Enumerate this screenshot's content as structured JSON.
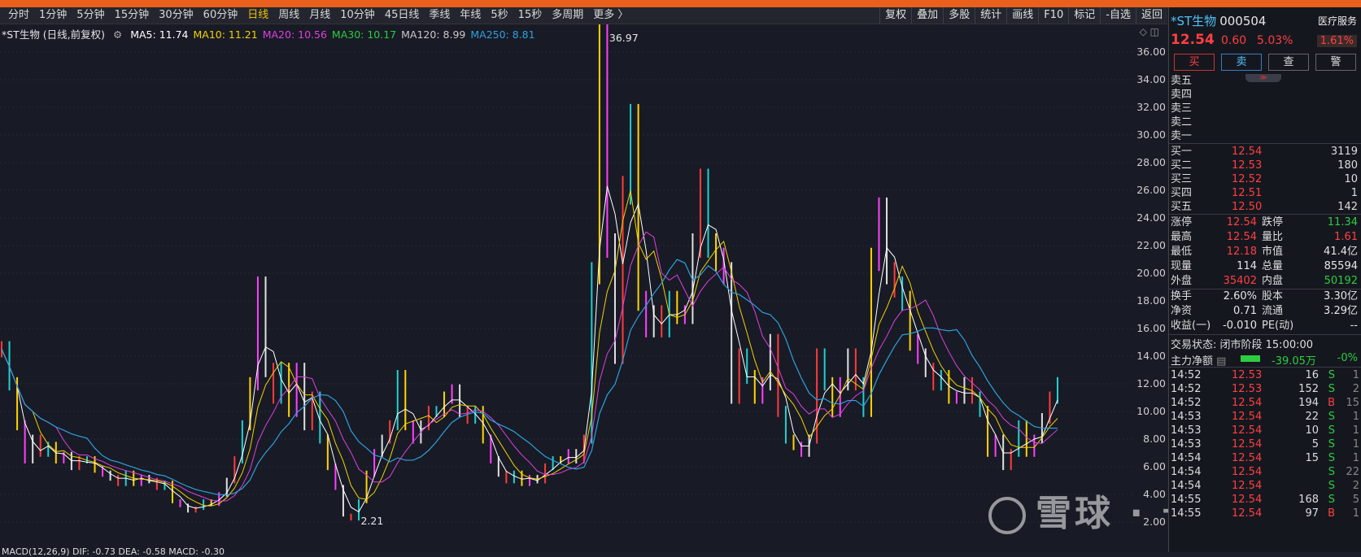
{
  "periods": [
    "分时",
    "1分钟",
    "5分钟",
    "15分钟",
    "30分钟",
    "60分钟",
    "日线",
    "周线",
    "月线",
    "10分钟",
    "45日线",
    "季线",
    "年线",
    "5秒",
    "15秒",
    "多周期",
    "更多 〉"
  ],
  "active_period": "日线",
  "tools": [
    "复权",
    "叠加",
    "多股",
    "统计",
    "画线",
    "F10",
    "标记",
    "-自选",
    "返回"
  ],
  "chart_title": "*ST生物 (日线,前复权)",
  "ma": [
    {
      "label": "MA5: 11.74",
      "color": "#ffffff"
    },
    {
      "label": "MA10: 11.21",
      "color": "#f5d000"
    },
    {
      "label": "MA20: 10.56",
      "color": "#e040e0"
    },
    {
      "label": "MA30: 10.17",
      "color": "#2ecc40"
    },
    {
      "label": "MA120: 8.99",
      "color": "#c8c8c8"
    },
    {
      "label": "MA250: 8.81",
      "color": "#2f9fe0"
    }
  ],
  "y_ticks": [
    "36.00",
    "34.00",
    "32.00",
    "30.00",
    "28.00",
    "26.00",
    "24.00",
    "22.00",
    "20.00",
    "18.00",
    "16.00",
    "14.00",
    "12.00",
    "10.00",
    "8.00",
    "6.00",
    "4.00",
    "2.00"
  ],
  "high_label": "36.97",
  "low_label": "2.21",
  "bottom_indicator": "MACD(12,26,9)  DIF: -0.73  DEA: -0.58  MACD: -0.30",
  "watermark": "雪球 · 长牛乱舞",
  "chart_data": {
    "type": "line",
    "title": "*ST生物 (日线,前复权)",
    "xlabel": "",
    "ylabel": "",
    "ylim": [
      1,
      37.5
    ],
    "series": [
      {
        "name": "*ST生物",
        "values": [
          14.5,
          12,
          9,
          6.5,
          8,
          7,
          7.5,
          6.5,
          6.8,
          6,
          6.5,
          6.5,
          5.8,
          5.5,
          5.2,
          4.8,
          5.5,
          4.8,
          5.2,
          5,
          4.5,
          4.8,
          3.5,
          3.2,
          2.8,
          3,
          3.5,
          3.3,
          4,
          5,
          6.5,
          9,
          12,
          19,
          13,
          11,
          13,
          10,
          13,
          9,
          11,
          8,
          6,
          4.5,
          2.5,
          2.2,
          3.5,
          5.5,
          7,
          8,
          9,
          12.5,
          9,
          8,
          9,
          10,
          10,
          11,
          11.5,
          10,
          9.5,
          10,
          8,
          6.5,
          5.5,
          5,
          5.5,
          4.8,
          5.2,
          5,
          6,
          6.5,
          6.5,
          7,
          6.5,
          8,
          20,
          36.9,
          22,
          14,
          26,
          31,
          18,
          16,
          17,
          16,
          18,
          17,
          17,
          22,
          26.5,
          22,
          21,
          20,
          11,
          14,
          12.5,
          11,
          12,
          15,
          10,
          8,
          7.5,
          7,
          8,
          14,
          12,
          10,
          12,
          14,
          12,
          10,
          21,
          24.5,
          20,
          19,
          18,
          15,
          14,
          13,
          12,
          12.5,
          11,
          11,
          12,
          11,
          10,
          7,
          8,
          6,
          7,
          9,
          7,
          8,
          9.5,
          11,
          12
        ]
      }
    ]
  },
  "panel": {
    "name": "*ST生物",
    "code": "000504",
    "industry": "医疗服务",
    "price": "12.54",
    "change": "0.60",
    "pct": "5.03%",
    "ind_pct": "1.61%",
    "buttons": [
      "买",
      "卖",
      "查",
      "警"
    ],
    "handle": "≫",
    "asks": [
      {
        "label": "卖五"
      },
      {
        "label": "卖四"
      },
      {
        "label": "卖三"
      },
      {
        "label": "卖二"
      },
      {
        "label": "卖一"
      }
    ],
    "bids": [
      {
        "label": "买一",
        "price": "12.54",
        "vol": "3119"
      },
      {
        "label": "买二",
        "price": "12.53",
        "vol": "180"
      },
      {
        "label": "买三",
        "price": "12.52",
        "vol": "10"
      },
      {
        "label": "买四",
        "price": "12.51",
        "vol": "1"
      },
      {
        "label": "买五",
        "price": "12.50",
        "vol": "142"
      }
    ],
    "stats": [
      {
        "k1": "涨停",
        "v1": "12.54",
        "c1": "red",
        "k2": "跌停",
        "v2": "11.34",
        "c2": "green"
      },
      {
        "k1": "最高",
        "v1": "12.54",
        "c1": "red",
        "k2": "量比",
        "v2": "1.61",
        "c2": "red"
      },
      {
        "k1": "最低",
        "v1": "12.18",
        "c1": "red",
        "k2": "市值",
        "v2": "41.4亿",
        "c2": "white"
      },
      {
        "k1": "现量",
        "v1": "114",
        "c1": "white",
        "k2": "总量",
        "v2": "85594",
        "c2": "white"
      },
      {
        "k1": "外盘",
        "v1": "35402",
        "c1": "red",
        "k2": "内盘",
        "v2": "50192",
        "c2": "green"
      }
    ],
    "stats2": [
      {
        "k1": "换手",
        "v1": "2.60%",
        "c1": "white",
        "k2": "股本",
        "v2": "3.30亿",
        "c2": "white"
      },
      {
        "k1": "净资",
        "v1": "0.71",
        "c1": "white",
        "k2": "流通",
        "v2": "3.29亿",
        "c2": "white"
      },
      {
        "k1": "收益(一)",
        "v1": "-0.010",
        "c1": "white",
        "k2": "PE(动)",
        "v2": "--",
        "c2": "white"
      }
    ],
    "trade_status": "交易状态: 闭市阶段 15:00:00",
    "flow_label": "主力净额",
    "flow_value": "-39.05万",
    "flow_pct": "-0%",
    "ticks": [
      {
        "t": "14:52",
        "p": "12.53",
        "v": "16",
        "s": "S",
        "n": "1"
      },
      {
        "t": "14:52",
        "p": "12.53",
        "v": "152",
        "s": "S",
        "n": "2"
      },
      {
        "t": "14:52",
        "p": "12.54",
        "v": "194",
        "s": "B",
        "n": "15"
      },
      {
        "t": "14:53",
        "p": "12.54",
        "v": "22",
        "s": "S",
        "n": "1"
      },
      {
        "t": "14:53",
        "p": "12.54",
        "v": "10",
        "s": "S",
        "n": "1"
      },
      {
        "t": "14:53",
        "p": "12.54",
        "v": "5",
        "s": "S",
        "n": "1"
      },
      {
        "t": "14:54",
        "p": "12.54",
        "v": "15",
        "s": "S",
        "n": "1"
      },
      {
        "t": "14:54",
        "p": "12.54",
        "v": "",
        "s": "S",
        "n": "22"
      },
      {
        "t": "14:54",
        "p": "12.54",
        "v": "",
        "s": "S",
        "n": "2"
      },
      {
        "t": "14:55",
        "p": "12.54",
        "v": "168",
        "s": "S",
        "n": "5"
      },
      {
        "t": "14:55",
        "p": "12.54",
        "v": "97",
        "s": "B",
        "n": "1"
      }
    ]
  }
}
